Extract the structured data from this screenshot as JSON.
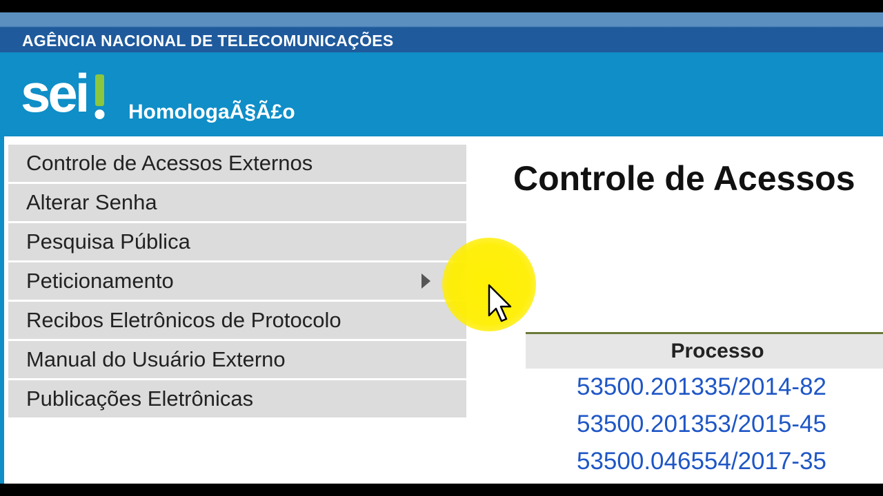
{
  "header": {
    "agency": "AGÊNCIA NACIONAL DE TELECOMUNICAÇÕES",
    "logo_text": "sei!",
    "environment": "HomologaÃ§Ã£o"
  },
  "menu": {
    "items": [
      {
        "label": "Controle de Acessos Externos",
        "has_submenu": false
      },
      {
        "label": "Alterar Senha",
        "has_submenu": false
      },
      {
        "label": "Pesquisa Pública",
        "has_submenu": false
      },
      {
        "label": "Peticionamento",
        "has_submenu": true
      },
      {
        "label": "Recibos Eletrônicos de Protocolo",
        "has_submenu": false
      },
      {
        "label": "Manual do Usuário Externo",
        "has_submenu": false
      },
      {
        "label": "Publicações Eletrônicas",
        "has_submenu": false
      }
    ]
  },
  "main": {
    "title": "Controle de Acessos",
    "table": {
      "column_header": "Processo",
      "rows": [
        "53500.201335/2014-82",
        "53500.201353/2015-45",
        "53500.046554/2017-35"
      ]
    }
  },
  "colors": {
    "agency_bar": "#1f5a9c",
    "header_bg": "#0f8ec7",
    "menu_item_bg": "#dcdcdc",
    "link": "#1e56c6",
    "cursor_highlight": "#ffee00"
  }
}
